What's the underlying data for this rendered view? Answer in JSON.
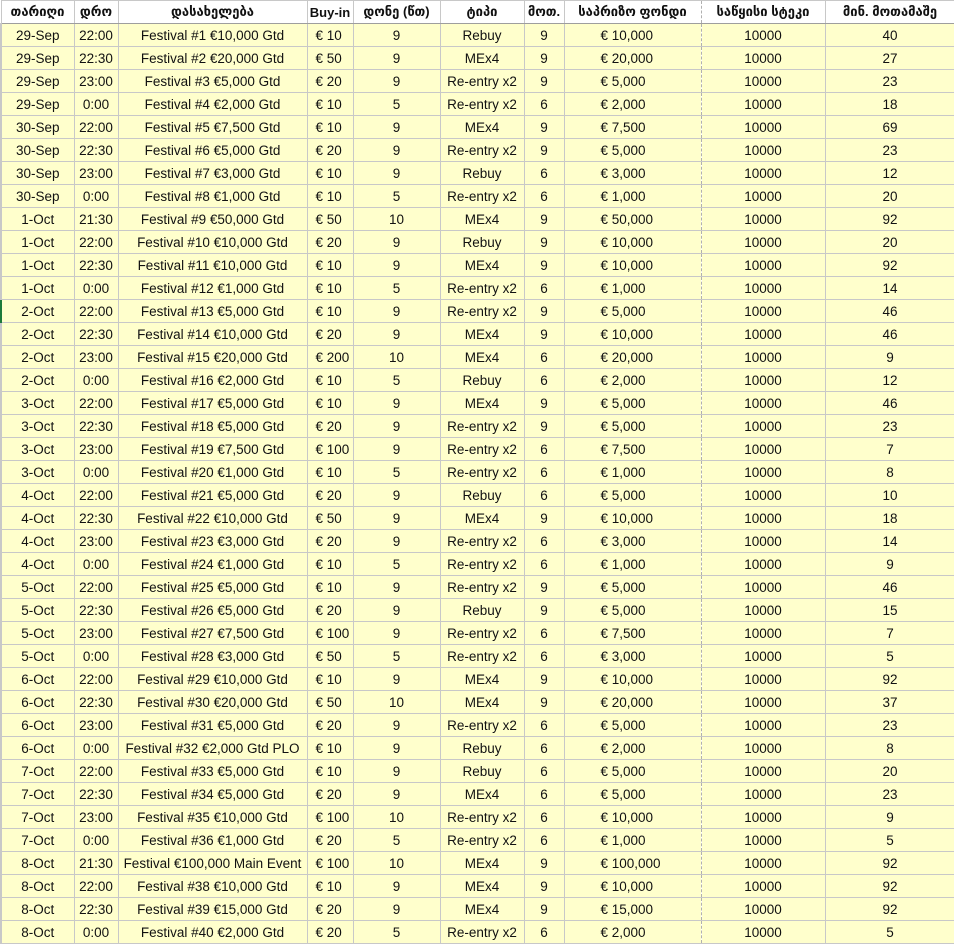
{
  "headers": {
    "date": "თარიღი",
    "time": "დრო",
    "name": "დასახელება",
    "buyin": "Buy-in",
    "level": "დონე (წთ)",
    "type": "ტიპი",
    "players": "მოთ.",
    "pool": "საპრიზო ფონდი",
    "stack": "საწყისი სტეკი",
    "minpl": "მინ. მოთამაშე"
  },
  "rows": [
    {
      "date": "29-Sep",
      "time": "22:00",
      "name": "Festival #1 €10,000 Gtd",
      "buyin": "€ 10",
      "level": "9",
      "type": "Rebuy",
      "players": "9",
      "pool": "€ 10,000",
      "stack": "10000",
      "minpl": "40"
    },
    {
      "date": "29-Sep",
      "time": "22:30",
      "name": "Festival #2 €20,000 Gtd",
      "buyin": "€ 50",
      "level": "9",
      "type": "MEx4",
      "players": "9",
      "pool": "€ 20,000",
      "stack": "10000",
      "minpl": "27"
    },
    {
      "date": "29-Sep",
      "time": "23:00",
      "name": "Festival #3 €5,000 Gtd",
      "buyin": "€ 20",
      "level": "9",
      "type": "Re-entry x2",
      "players": "9",
      "pool": "€ 5,000",
      "stack": "10000",
      "minpl": "23"
    },
    {
      "date": "29-Sep",
      "time": "0:00",
      "name": "Festival #4 €2,000 Gtd",
      "buyin": "€ 10",
      "level": "5",
      "type": "Re-entry x2",
      "players": "6",
      "pool": "€ 2,000",
      "stack": "10000",
      "minpl": "18"
    },
    {
      "date": "30-Sep",
      "time": "22:00",
      "name": "Festival #5 €7,500 Gtd",
      "buyin": "€ 10",
      "level": "9",
      "type": "MEx4",
      "players": "9",
      "pool": "€ 7,500",
      "stack": "10000",
      "minpl": "69"
    },
    {
      "date": "30-Sep",
      "time": "22:30",
      "name": "Festival #6 €5,000 Gtd",
      "buyin": "€ 20",
      "level": "9",
      "type": "Re-entry x2",
      "players": "9",
      "pool": "€ 5,000",
      "stack": "10000",
      "minpl": "23"
    },
    {
      "date": "30-Sep",
      "time": "23:00",
      "name": "Festival #7 €3,000 Gtd",
      "buyin": "€ 10",
      "level": "9",
      "type": "Rebuy",
      "players": "6",
      "pool": "€ 3,000",
      "stack": "10000",
      "minpl": "12"
    },
    {
      "date": "30-Sep",
      "time": "0:00",
      "name": "Festival #8 €1,000 Gtd",
      "buyin": "€ 10",
      "level": "5",
      "type": "Re-entry x2",
      "players": "6",
      "pool": "€ 1,000",
      "stack": "10000",
      "minpl": "20"
    },
    {
      "date": "1-Oct",
      "time": "21:30",
      "name": "Festival #9 €50,000 Gtd",
      "buyin": "€ 50",
      "level": "10",
      "type": "MEx4",
      "players": "9",
      "pool": "€ 50,000",
      "stack": "10000",
      "minpl": "92"
    },
    {
      "date": "1-Oct",
      "time": "22:00",
      "name": "Festival #10 €10,000 Gtd",
      "buyin": "€ 20",
      "level": "9",
      "type": "Rebuy",
      "players": "9",
      "pool": "€ 10,000",
      "stack": "10000",
      "minpl": "20"
    },
    {
      "date": "1-Oct",
      "time": "22:30",
      "name": "Festival #11 €10,000 Gtd",
      "buyin": "€ 10",
      "level": "9",
      "type": "MEx4",
      "players": "9",
      "pool": "€ 10,000",
      "stack": "10000",
      "minpl": "92"
    },
    {
      "date": "1-Oct",
      "time": "0:00",
      "name": "Festival #12 €1,000 Gtd",
      "buyin": "€ 10",
      "level": "5",
      "type": "Re-entry x2",
      "players": "6",
      "pool": "€ 1,000",
      "stack": "10000",
      "minpl": "14"
    },
    {
      "date": "2-Oct",
      "time": "22:00",
      "name": "Festival #13 €5,000 Gtd",
      "buyin": "€ 10",
      "level": "9",
      "type": "Re-entry x2",
      "players": "9",
      "pool": "€ 5,000",
      "stack": "10000",
      "minpl": "46",
      "selected": true
    },
    {
      "date": "2-Oct",
      "time": "22:30",
      "name": "Festival #14 €10,000 Gtd",
      "buyin": "€ 20",
      "level": "9",
      "type": "MEx4",
      "players": "9",
      "pool": "€ 10,000",
      "stack": "10000",
      "minpl": "46"
    },
    {
      "date": "2-Oct",
      "time": "23:00",
      "name": "Festival #15 €20,000 Gtd",
      "buyin": "€ 200",
      "level": "10",
      "type": "MEx4",
      "players": "6",
      "pool": "€ 20,000",
      "stack": "10000",
      "minpl": "9"
    },
    {
      "date": "2-Oct",
      "time": "0:00",
      "name": "Festival #16 €2,000 Gtd",
      "buyin": "€ 10",
      "level": "5",
      "type": "Rebuy",
      "players": "6",
      "pool": "€ 2,000",
      "stack": "10000",
      "minpl": "12"
    },
    {
      "date": "3-Oct",
      "time": "22:00",
      "name": "Festival #17 €5,000 Gtd",
      "buyin": "€ 10",
      "level": "9",
      "type": "MEx4",
      "players": "9",
      "pool": "€ 5,000",
      "stack": "10000",
      "minpl": "46"
    },
    {
      "date": "3-Oct",
      "time": "22:30",
      "name": "Festival #18 €5,000 Gtd",
      "buyin": "€ 20",
      "level": "9",
      "type": "Re-entry x2",
      "players": "9",
      "pool": "€ 5,000",
      "stack": "10000",
      "minpl": "23"
    },
    {
      "date": "3-Oct",
      "time": "23:00",
      "name": "Festival #19 €7,500 Gtd",
      "buyin": "€ 100",
      "level": "9",
      "type": "Re-entry x2",
      "players": "6",
      "pool": "€ 7,500",
      "stack": "10000",
      "minpl": "7"
    },
    {
      "date": "3-Oct",
      "time": "0:00",
      "name": "Festival #20 €1,000 Gtd",
      "buyin": "€ 10",
      "level": "5",
      "type": "Re-entry x2",
      "players": "6",
      "pool": "€ 1,000",
      "stack": "10000",
      "minpl": "8"
    },
    {
      "date": "4-Oct",
      "time": "22:00",
      "name": "Festival #21 €5,000 Gtd",
      "buyin": "€ 20",
      "level": "9",
      "type": "Rebuy",
      "players": "6",
      "pool": "€ 5,000",
      "stack": "10000",
      "minpl": "10"
    },
    {
      "date": "4-Oct",
      "time": "22:30",
      "name": "Festival #22 €10,000 Gtd",
      "buyin": "€ 50",
      "level": "9",
      "type": "MEx4",
      "players": "9",
      "pool": "€ 10,000",
      "stack": "10000",
      "minpl": "18"
    },
    {
      "date": "4-Oct",
      "time": "23:00",
      "name": "Festival #23 €3,000 Gtd",
      "buyin": "€ 20",
      "level": "9",
      "type": "Re-entry x2",
      "players": "6",
      "pool": "€ 3,000",
      "stack": "10000",
      "minpl": "14"
    },
    {
      "date": "4-Oct",
      "time": "0:00",
      "name": "Festival #24 €1,000 Gtd",
      "buyin": "€ 10",
      "level": "5",
      "type": "Re-entry x2",
      "players": "6",
      "pool": "€ 1,000",
      "stack": "10000",
      "minpl": "9"
    },
    {
      "date": "5-Oct",
      "time": "22:00",
      "name": "Festival #25 €5,000 Gtd",
      "buyin": "€ 10",
      "level": "9",
      "type": "Re-entry x2",
      "players": "9",
      "pool": "€ 5,000",
      "stack": "10000",
      "minpl": "46"
    },
    {
      "date": "5-Oct",
      "time": "22:30",
      "name": "Festival #26 €5,000 Gtd",
      "buyin": "€ 20",
      "level": "9",
      "type": "Rebuy",
      "players": "9",
      "pool": "€ 5,000",
      "stack": "10000",
      "minpl": "15"
    },
    {
      "date": "5-Oct",
      "time": "23:00",
      "name": "Festival #27 €7,500 Gtd",
      "buyin": "€ 100",
      "level": "9",
      "type": "Re-entry x2",
      "players": "6",
      "pool": "€ 7,500",
      "stack": "10000",
      "minpl": "7"
    },
    {
      "date": "5-Oct",
      "time": "0:00",
      "name": "Festival #28 €3,000 Gtd",
      "buyin": "€ 50",
      "level": "5",
      "type": "Re-entry x2",
      "players": "6",
      "pool": "€ 3,000",
      "stack": "10000",
      "minpl": "5"
    },
    {
      "date": "6-Oct",
      "time": "22:00",
      "name": "Festival #29 €10,000 Gtd",
      "buyin": "€ 10",
      "level": "9",
      "type": "MEx4",
      "players": "9",
      "pool": "€ 10,000",
      "stack": "10000",
      "minpl": "92"
    },
    {
      "date": "6-Oct",
      "time": "22:30",
      "name": "Festival #30 €20,000 Gtd",
      "buyin": "€ 50",
      "level": "10",
      "type": "MEx4",
      "players": "9",
      "pool": "€ 20,000",
      "stack": "10000",
      "minpl": "37"
    },
    {
      "date": "6-Oct",
      "time": "23:00",
      "name": "Festival #31 €5,000 Gtd",
      "buyin": "€ 20",
      "level": "9",
      "type": "Re-entry x2",
      "players": "6",
      "pool": "€ 5,000",
      "stack": "10000",
      "minpl": "23"
    },
    {
      "date": "6-Oct",
      "time": "0:00",
      "name": "Festival #32 €2,000 Gtd PLO",
      "buyin": "€ 10",
      "level": "9",
      "type": "Rebuy",
      "players": "6",
      "pool": "€ 2,000",
      "stack": "10000",
      "minpl": "8"
    },
    {
      "date": "7-Oct",
      "time": "22:00",
      "name": "Festival #33 €5,000 Gtd",
      "buyin": "€ 10",
      "level": "9",
      "type": "Rebuy",
      "players": "6",
      "pool": "€ 5,000",
      "stack": "10000",
      "minpl": "20"
    },
    {
      "date": "7-Oct",
      "time": "22:30",
      "name": "Festival #34 €5,000 Gtd",
      "buyin": "€ 20",
      "level": "9",
      "type": "MEx4",
      "players": "6",
      "pool": "€ 5,000",
      "stack": "10000",
      "minpl": "23"
    },
    {
      "date": "7-Oct",
      "time": "23:00",
      "name": "Festival #35 €10,000 Gtd",
      "buyin": "€ 100",
      "level": "10",
      "type": "Re-entry x2",
      "players": "6",
      "pool": "€ 10,000",
      "stack": "10000",
      "minpl": "9"
    },
    {
      "date": "7-Oct",
      "time": "0:00",
      "name": "Festival #36 €1,000 Gtd",
      "buyin": "€ 20",
      "level": "5",
      "type": "Re-entry x2",
      "players": "6",
      "pool": "€ 1,000",
      "stack": "10000",
      "minpl": "5"
    },
    {
      "date": "8-Oct",
      "time": "21:30",
      "name": "Festival €100,000 Main Event",
      "buyin": "€ 100",
      "level": "10",
      "type": "MEx4",
      "players": "9",
      "pool": "€ 100,000",
      "stack": "10000",
      "minpl": "92"
    },
    {
      "date": "8-Oct",
      "time": "22:00",
      "name": "Festival #38 €10,000 Gtd",
      "buyin": "€ 10",
      "level": "9",
      "type": "MEx4",
      "players": "9",
      "pool": "€ 10,000",
      "stack": "10000",
      "minpl": "92"
    },
    {
      "date": "8-Oct",
      "time": "22:30",
      "name": "Festival #39 €15,000 Gtd",
      "buyin": "€ 20",
      "level": "9",
      "type": "MEx4",
      "players": "9",
      "pool": "€ 15,000",
      "stack": "10000",
      "minpl": "92"
    },
    {
      "date": "8-Oct",
      "time": "0:00",
      "name": "Festival #40 €2,000 Gtd",
      "buyin": "€ 20",
      "level": "5",
      "type": "Re-entry x2",
      "players": "6",
      "pool": "€ 2,000",
      "stack": "10000",
      "minpl": "5"
    }
  ],
  "colors": {
    "cell_background": "#ffffcc",
    "header_background": "#ffffff",
    "grid_line": "#c8c8c8",
    "selection_marker": "#1d7a3a"
  }
}
